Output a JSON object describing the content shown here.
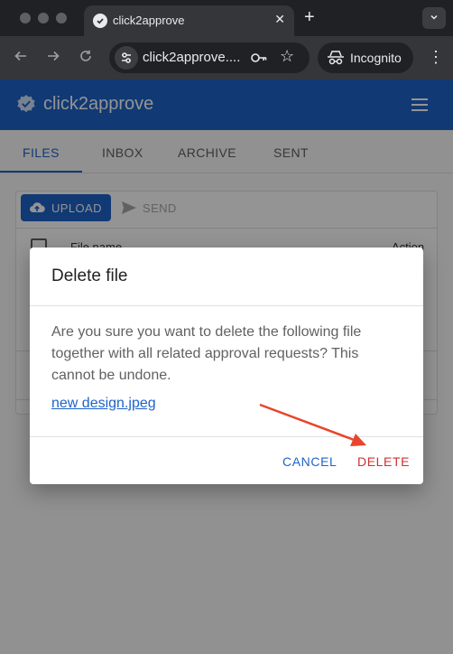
{
  "browser": {
    "tab_title": "click2approve",
    "tab_close": "✕",
    "new_tab": "+",
    "url": "click2approve....",
    "incognito_label": "Incognito"
  },
  "app": {
    "brand": "click2approve",
    "accent_color": "#1e63c8",
    "tabs": [
      {
        "label": "FILES",
        "active": true
      },
      {
        "label": "INBOX",
        "active": false
      },
      {
        "label": "ARCHIVE",
        "active": false
      },
      {
        "label": "SENT",
        "active": false
      }
    ],
    "toolbar": {
      "upload_label": "UPLOAD",
      "send_label": "SEND"
    },
    "table": {
      "columns": [
        "File name",
        "Action"
      ]
    }
  },
  "dialog": {
    "title": "Delete file",
    "body": "Are you sure you want to delete the following file together with all related approval requests? This cannot be undone.",
    "file_name": "new design.jpeg",
    "cancel_label": "CANCEL",
    "delete_label": "DELETE",
    "delete_color": "#d32f2f"
  },
  "annotation": {
    "arrow_color": "#e8452c"
  }
}
